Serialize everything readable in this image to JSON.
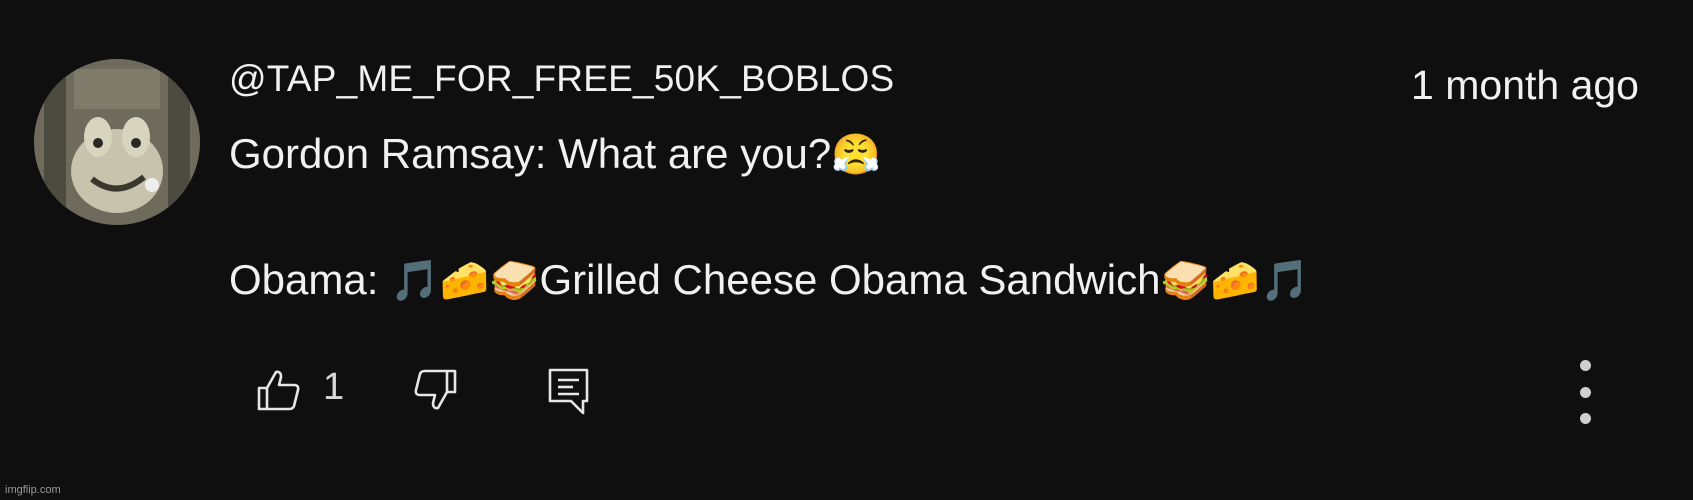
{
  "comment": {
    "author": "@TAP_ME_FOR_FREE_50K_BOBLOS",
    "timestamp": "1 month ago",
    "lines": [
      {
        "text_before": "Gordon Ramsay: What are you?",
        "emoji_after": "😤"
      },
      {
        "prefix": "Obama: ",
        "emoji_before": "🎵🧀🥪",
        "text": "Grilled Cheese Obama Sandwich",
        "emoji_after": "🥪🧀🎵"
      }
    ]
  },
  "actions": {
    "like_icon": "thumbs-up-icon",
    "like_count": "1",
    "dislike_icon": "thumbs-down-icon",
    "reply_icon": "reply-comment-icon",
    "more_icon": "vertical-ellipsis-icon"
  },
  "watermark": "imgflip.com"
}
